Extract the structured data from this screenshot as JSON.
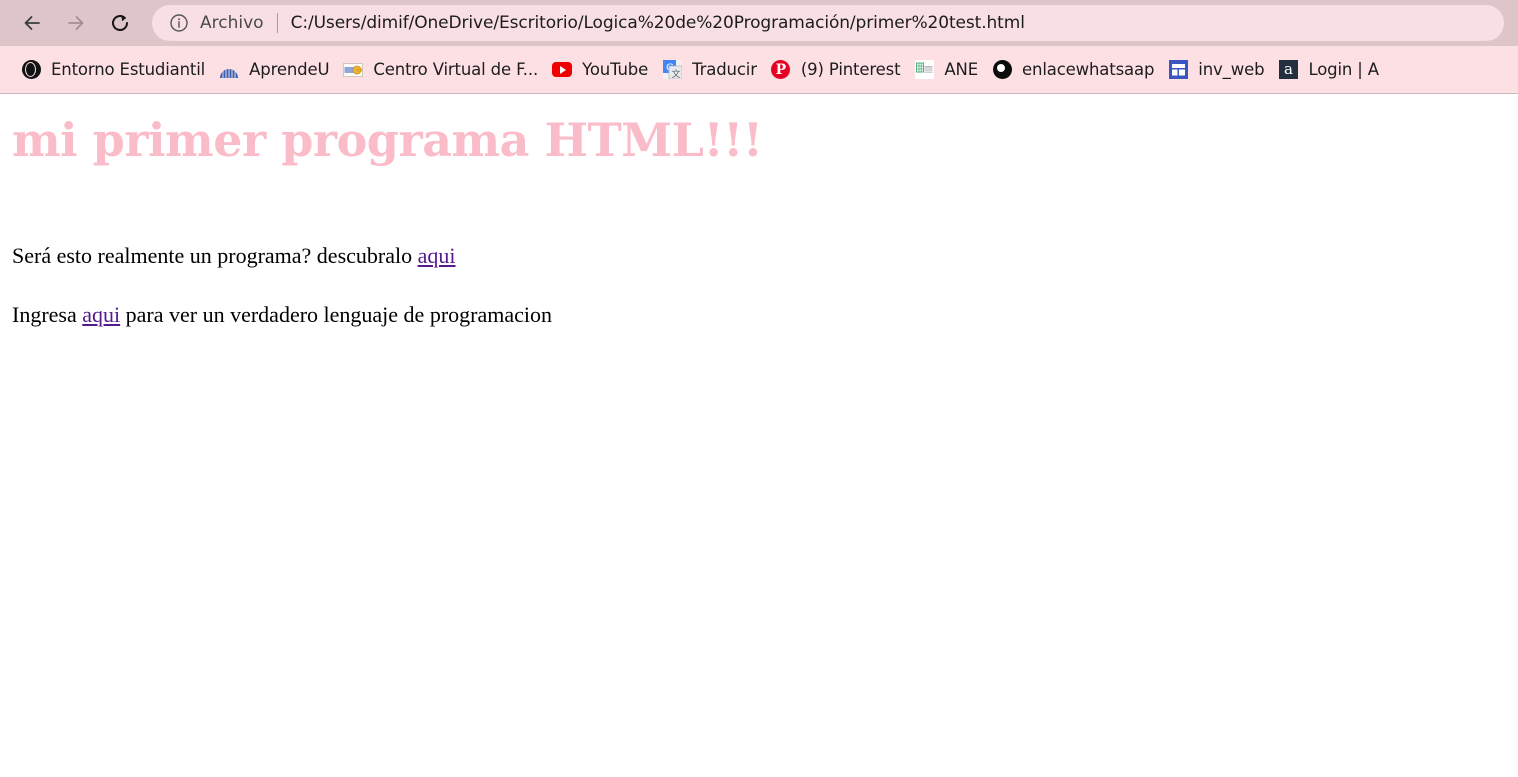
{
  "browser": {
    "nav": {
      "back_icon": "arrow-left-icon",
      "forward_icon": "arrow-right-icon",
      "reload_icon": "reload-icon"
    },
    "omnibox": {
      "info_icon": "info-circle-icon",
      "scheme_label": "Archivo",
      "url": "C:/Users/dimif/OneDrive/Escritorio/Logica%20de%20Programación/primer%20test.html"
    },
    "bookmarks": [
      {
        "label": "Entorno Estudiantil",
        "icon": "globe-icon"
      },
      {
        "label": "AprendeU",
        "icon": "fan-logo-icon"
      },
      {
        "label": "Centro Virtual de F...",
        "icon": "key-icon"
      },
      {
        "label": "YouTube",
        "icon": "youtube-icon"
      },
      {
        "label": "Traducir",
        "icon": "google-translate-icon"
      },
      {
        "label": "(9) Pinterest",
        "icon": "pinterest-icon"
      },
      {
        "label": "ANE",
        "icon": "spreadsheet-icon"
      },
      {
        "label": "enlacewhatsaap",
        "icon": "whatsapp-dark-icon"
      },
      {
        "label": "inv_web",
        "icon": "layout-blocks-icon"
      },
      {
        "label": "Login | A",
        "icon": "amazon-icon"
      }
    ]
  },
  "page": {
    "heading": "mi primer programa HTML!!!",
    "paragraph1": {
      "before_link": "Será esto realmente un programa? descubralo ",
      "link": "aqui",
      "after_link": ""
    },
    "paragraph2": {
      "before_link": "Ingresa ",
      "link": "aqui",
      "after_link": " para ver un verdadero lenguaje de programacion"
    }
  },
  "colors": {
    "toolbar_bg": "#dec5ca",
    "bookmarks_bg": "#fce0e4",
    "omnibox_bg": "#f8dfe3",
    "heading_pink": "#f9bcc8",
    "visited_link": "#551a8b"
  }
}
